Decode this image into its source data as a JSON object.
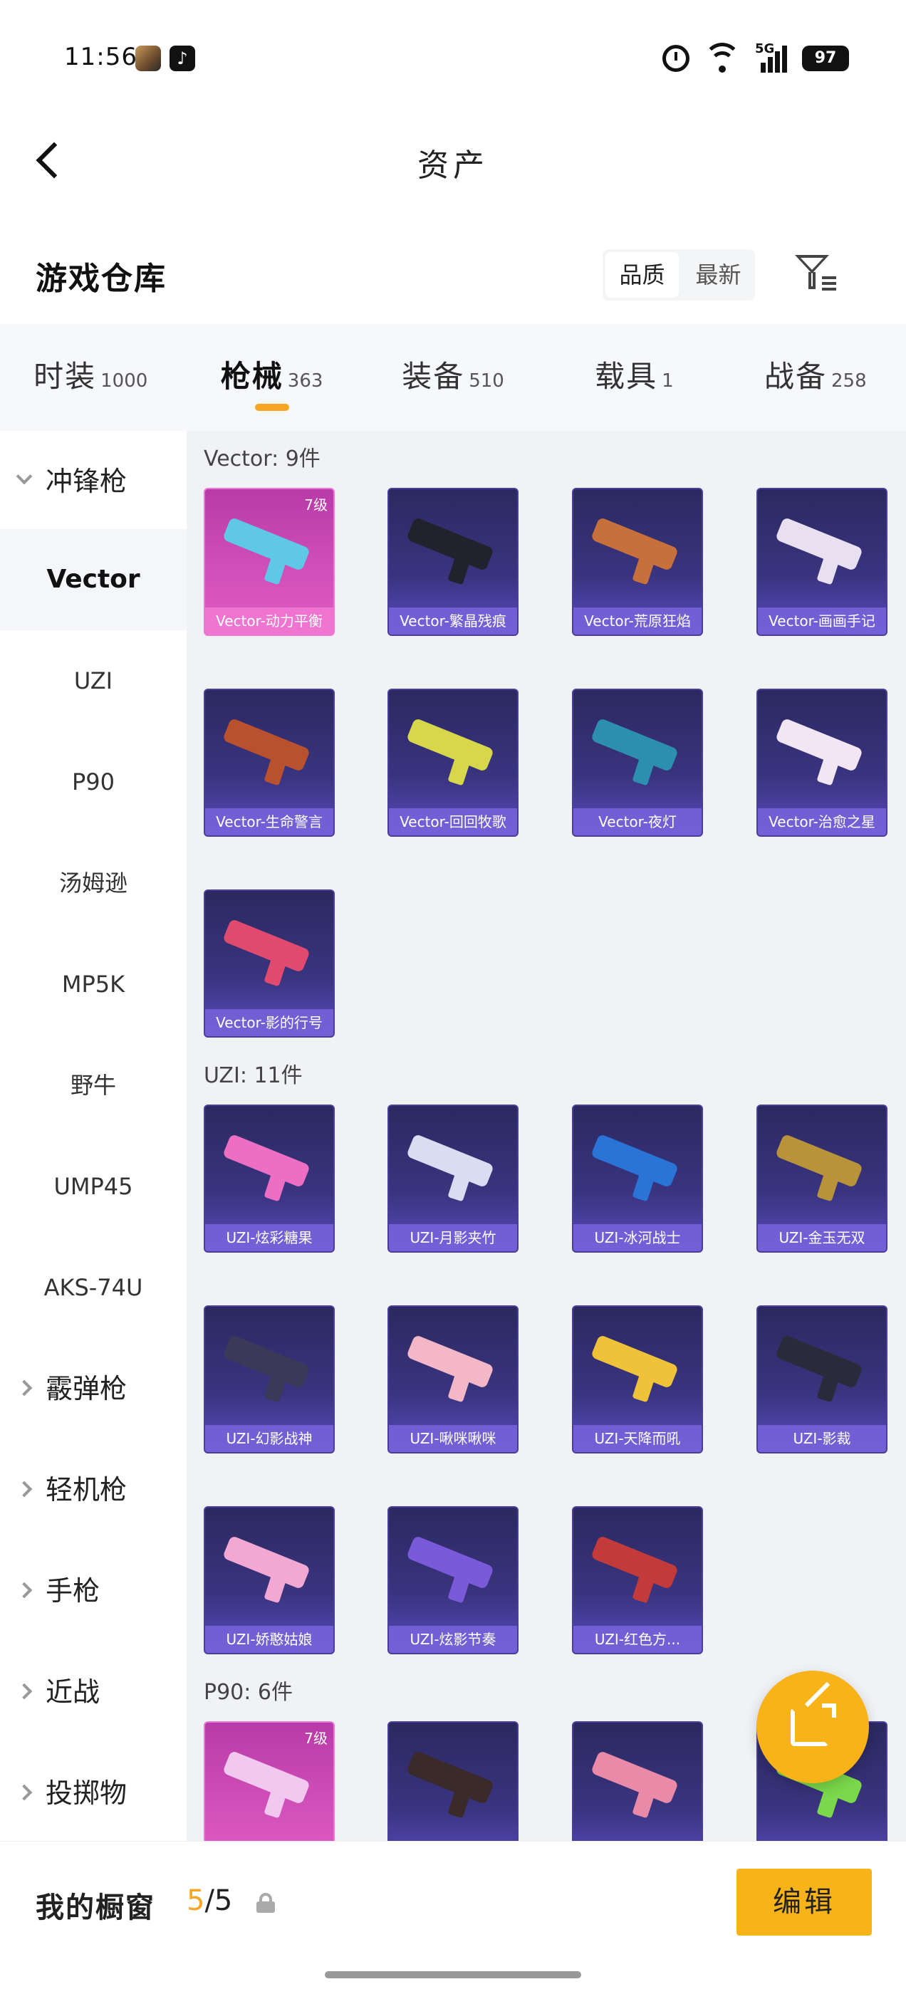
{
  "status_bar": {
    "time": "11:56",
    "network": "5G",
    "battery": "97",
    "tiktok_glyph": "♪"
  },
  "header": {
    "title": "资产"
  },
  "warehouse": {
    "title": "游戏仓库",
    "sort_options": [
      "品质",
      "最新"
    ],
    "sort_selected": "品质"
  },
  "tabs": [
    {
      "label": "时装",
      "count": "1000",
      "active": false
    },
    {
      "label": "枪械",
      "count": "363",
      "active": true
    },
    {
      "label": "装备",
      "count": "510",
      "active": false
    },
    {
      "label": "载具",
      "count": "1",
      "active": false
    },
    {
      "label": "战备",
      "count": "258",
      "active": false
    }
  ],
  "sidebar": {
    "items": [
      {
        "label": "冲锋枪",
        "type": "category",
        "expanded": true
      },
      {
        "label": "Vector",
        "type": "weapon",
        "active": true
      },
      {
        "label": "UZI",
        "type": "weapon"
      },
      {
        "label": "P90",
        "type": "weapon"
      },
      {
        "label": "汤姆逊",
        "type": "weapon"
      },
      {
        "label": "MP5K",
        "type": "weapon"
      },
      {
        "label": "野牛",
        "type": "weapon"
      },
      {
        "label": "UMP45",
        "type": "weapon"
      },
      {
        "label": "AKS-74U",
        "type": "weapon"
      },
      {
        "label": "霰弹枪",
        "type": "category"
      },
      {
        "label": "轻机枪",
        "type": "category"
      },
      {
        "label": "手枪",
        "type": "category"
      },
      {
        "label": "近战",
        "type": "category"
      },
      {
        "label": "投掷物",
        "type": "category"
      }
    ]
  },
  "groups": [
    {
      "label": "Vector: 9件",
      "items": [
        {
          "name": "Vector-动力平衡",
          "grade": "7级",
          "rarity": "gold",
          "color": "#5fc7e8"
        },
        {
          "name": "Vector-繁晶残痕",
          "grade": "",
          "rarity": "purple",
          "color": "#22222e"
        },
        {
          "name": "Vector-荒原狂焰",
          "grade": "",
          "rarity": "purple",
          "color": "#c8703c"
        },
        {
          "name": "Vector-画画手记",
          "grade": "",
          "rarity": "purple",
          "color": "#e8e0f0"
        },
        {
          "name": "Vector-生命警言",
          "grade": "",
          "rarity": "purple",
          "color": "#b9502e"
        },
        {
          "name": "Vector-回回牧歌",
          "grade": "",
          "rarity": "purple",
          "color": "#d8d64a"
        },
        {
          "name": "Vector-夜灯",
          "grade": "",
          "rarity": "purple",
          "color": "#2c8fb0"
        },
        {
          "name": "Vector-治愈之星",
          "grade": "",
          "rarity": "purple",
          "color": "#f2e6f4"
        },
        {
          "name": "Vector-影的行号",
          "grade": "",
          "rarity": "purple",
          "color": "#e04a6e"
        }
      ]
    },
    {
      "label": "UZI: 11件",
      "items": [
        {
          "name": "UZI-炫彩糖果",
          "grade": "",
          "rarity": "purple",
          "color": "#ec6fc3"
        },
        {
          "name": "UZI-月影夹竹",
          "grade": "",
          "rarity": "purple",
          "color": "#d8ddf2"
        },
        {
          "name": "UZI-冰河战士",
          "grade": "",
          "rarity": "purple",
          "color": "#2a74d8"
        },
        {
          "name": "UZI-金玉无双",
          "grade": "",
          "rarity": "purple",
          "color": "#b8933a"
        },
        {
          "name": "UZI-幻影战神",
          "grade": "",
          "rarity": "purple",
          "color": "#3a3a58"
        },
        {
          "name": "UZI-啾咪啾咪",
          "grade": "",
          "rarity": "purple",
          "color": "#f4b7c8"
        },
        {
          "name": "UZI-天降而吼",
          "grade": "",
          "rarity": "purple",
          "color": "#f0c23a"
        },
        {
          "name": "UZI-影裁",
          "grade": "",
          "rarity": "purple",
          "color": "#2a2a3a"
        },
        {
          "name": "UZI-娇憨姑娘",
          "grade": "",
          "rarity": "purple",
          "color": "#f2a8d2"
        },
        {
          "name": "UZI-炫影节奏",
          "grade": "",
          "rarity": "purple",
          "color": "#7a5ad8"
        },
        {
          "name": "UZI-红色方...",
          "grade": "",
          "rarity": "purple",
          "color": "#c23a3a"
        }
      ]
    },
    {
      "label": "P90: 6件",
      "items": [
        {
          "name": "",
          "grade": "7级",
          "rarity": "gold",
          "color": "#f0c8f0"
        },
        {
          "name": "",
          "grade": "",
          "rarity": "purple",
          "color": "#3a2a2a"
        },
        {
          "name": "",
          "grade": "",
          "rarity": "purple",
          "color": "#e88aa8"
        },
        {
          "name": "",
          "grade": "",
          "rarity": "purple",
          "color": "#7ad84a"
        }
      ]
    }
  ],
  "bottom": {
    "showcase_label": "我的橱窗",
    "showcase_used": "5",
    "showcase_total": "/5",
    "edit_label": "编辑"
  }
}
